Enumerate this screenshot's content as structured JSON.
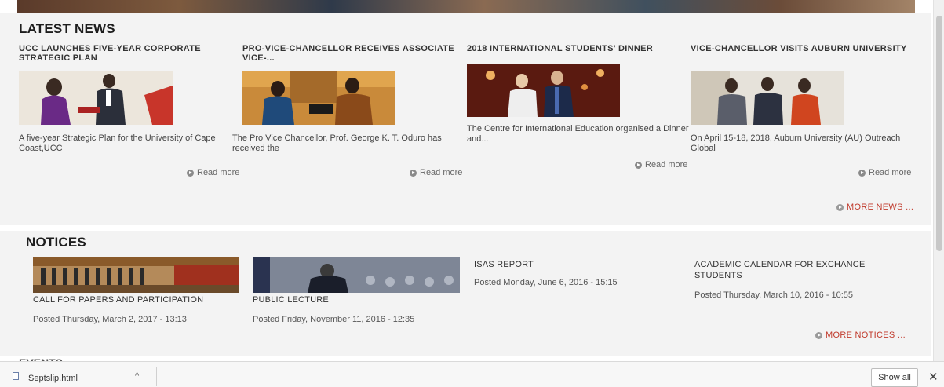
{
  "news": {
    "title": "LATEST NEWS",
    "items": [
      {
        "headline": "UCC LAUNCHES FIVE-YEAR CORPORATE STRATEGIC PLAN",
        "excerpt": "A five-year Strategic Plan for the University of Cape Coast,UCC",
        "read_more": "Read more"
      },
      {
        "headline": "PRO-VICE-CHANCELLOR RECEIVES ASSOCIATE VICE-...",
        "excerpt": "The Pro Vice Chancellor, Prof. George K. T. Oduro has received the",
        "read_more": "Read more"
      },
      {
        "headline": "2018 INTERNATIONAL STUDENTS' DINNER",
        "excerpt": "The Centre for International Education organised a Dinner and...",
        "read_more": "Read more"
      },
      {
        "headline": "VICE-CHANCELLOR VISITS AUBURN UNIVERSITY",
        "excerpt": "On April 15-18, 2018, Auburn University (AU) Outreach Global",
        "read_more": "Read more"
      }
    ],
    "more_label": "MORE NEWS ..."
  },
  "notices": {
    "title": "NOTICES",
    "items": [
      {
        "title": "CALL FOR PAPERS AND PARTICIPATION",
        "date": "Posted Thursday, March 2, 2017 - 13:13"
      },
      {
        "title": "PUBLIC LECTURE",
        "date": "Posted Friday, November 11, 2016 - 12:35"
      },
      {
        "title": "ISAS REPORT",
        "date": "Posted Monday, June 6, 2016 - 15:15"
      },
      {
        "title": "ACADEMIC CALENDAR FOR EXCHANCE STUDENTS",
        "date": "Posted Thursday, March 10, 2016 - 10:55"
      }
    ],
    "more_label": "MORE NOTICES ..."
  },
  "events": {
    "title": "EVENTS"
  },
  "download_bar": {
    "filename": "Septslip.html",
    "show_all": "Show all",
    "close_glyph": "✕",
    "chevron_glyph": "^"
  },
  "colors": {
    "accent": "#c0392b",
    "panel": "#f3f3f3"
  }
}
